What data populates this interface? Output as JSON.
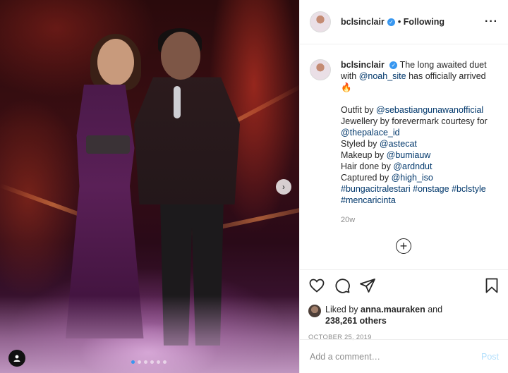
{
  "post": {
    "username": "bclsinclair",
    "follow_status": "Following",
    "more_icon": "more-horizontal-icon",
    "verified_icon": "verified-badge-icon",
    "media": {
      "slide_count": 6,
      "active_slide": 1
    },
    "caption": {
      "username": "bclsinclair",
      "lines": [
        [
          {
            "t": "The long awaited duet",
            "k": "text"
          }
        ],
        [
          {
            "t": "with ",
            "k": "text"
          },
          {
            "t": "@noah_site",
            "k": "mention"
          },
          {
            "t": " has officially arrived",
            "k": "text"
          }
        ],
        [
          {
            "t": "🔥",
            "k": "text"
          }
        ],
        [
          {
            "t": "",
            "k": "text"
          }
        ],
        [
          {
            "t": "Outfit by ",
            "k": "text"
          },
          {
            "t": "@sebastiangunawanofficial",
            "k": "mention"
          }
        ],
        [
          {
            "t": "Jewellery by forevermark courtesy for",
            "k": "text"
          }
        ],
        [
          {
            "t": "@thepalace_id",
            "k": "mention"
          }
        ],
        [
          {
            "t": "Styled by ",
            "k": "text"
          },
          {
            "t": "@astecat",
            "k": "mention"
          }
        ],
        [
          {
            "t": "Makeup by ",
            "k": "text"
          },
          {
            "t": "@bumiauw",
            "k": "mention"
          }
        ],
        [
          {
            "t": "Hair done by ",
            "k": "text"
          },
          {
            "t": "@ardndut",
            "k": "mention"
          }
        ],
        [
          {
            "t": "Captured by ",
            "k": "text"
          },
          {
            "t": "@high_iso",
            "k": "mention"
          }
        ],
        [
          {
            "t": "#bungacitralestari",
            "k": "tag"
          },
          {
            "t": " ",
            "k": "text"
          },
          {
            "t": "#onstage",
            "k": "tag"
          },
          {
            "t": " ",
            "k": "text"
          },
          {
            "t": "#bclstyle",
            "k": "tag"
          }
        ],
        [
          {
            "t": "#mencaricinta",
            "k": "tag"
          }
        ]
      ],
      "time_ago": "20w"
    },
    "load_more_icon": "plus-circle-icon",
    "likes": {
      "prefix": "Liked by ",
      "liker": "anna.mauraken",
      "middle": " and",
      "count": "238,261 others"
    },
    "date": "OCTOBER 25, 2019",
    "comment": {
      "placeholder": "Add a comment…",
      "post_label": "Post"
    }
  },
  "colors": {
    "link": "#00376b",
    "verified": "#3897f0",
    "secondary_text": "#8e8e8e",
    "post_button_disabled": "#b2dffc",
    "border": "#efefef"
  }
}
